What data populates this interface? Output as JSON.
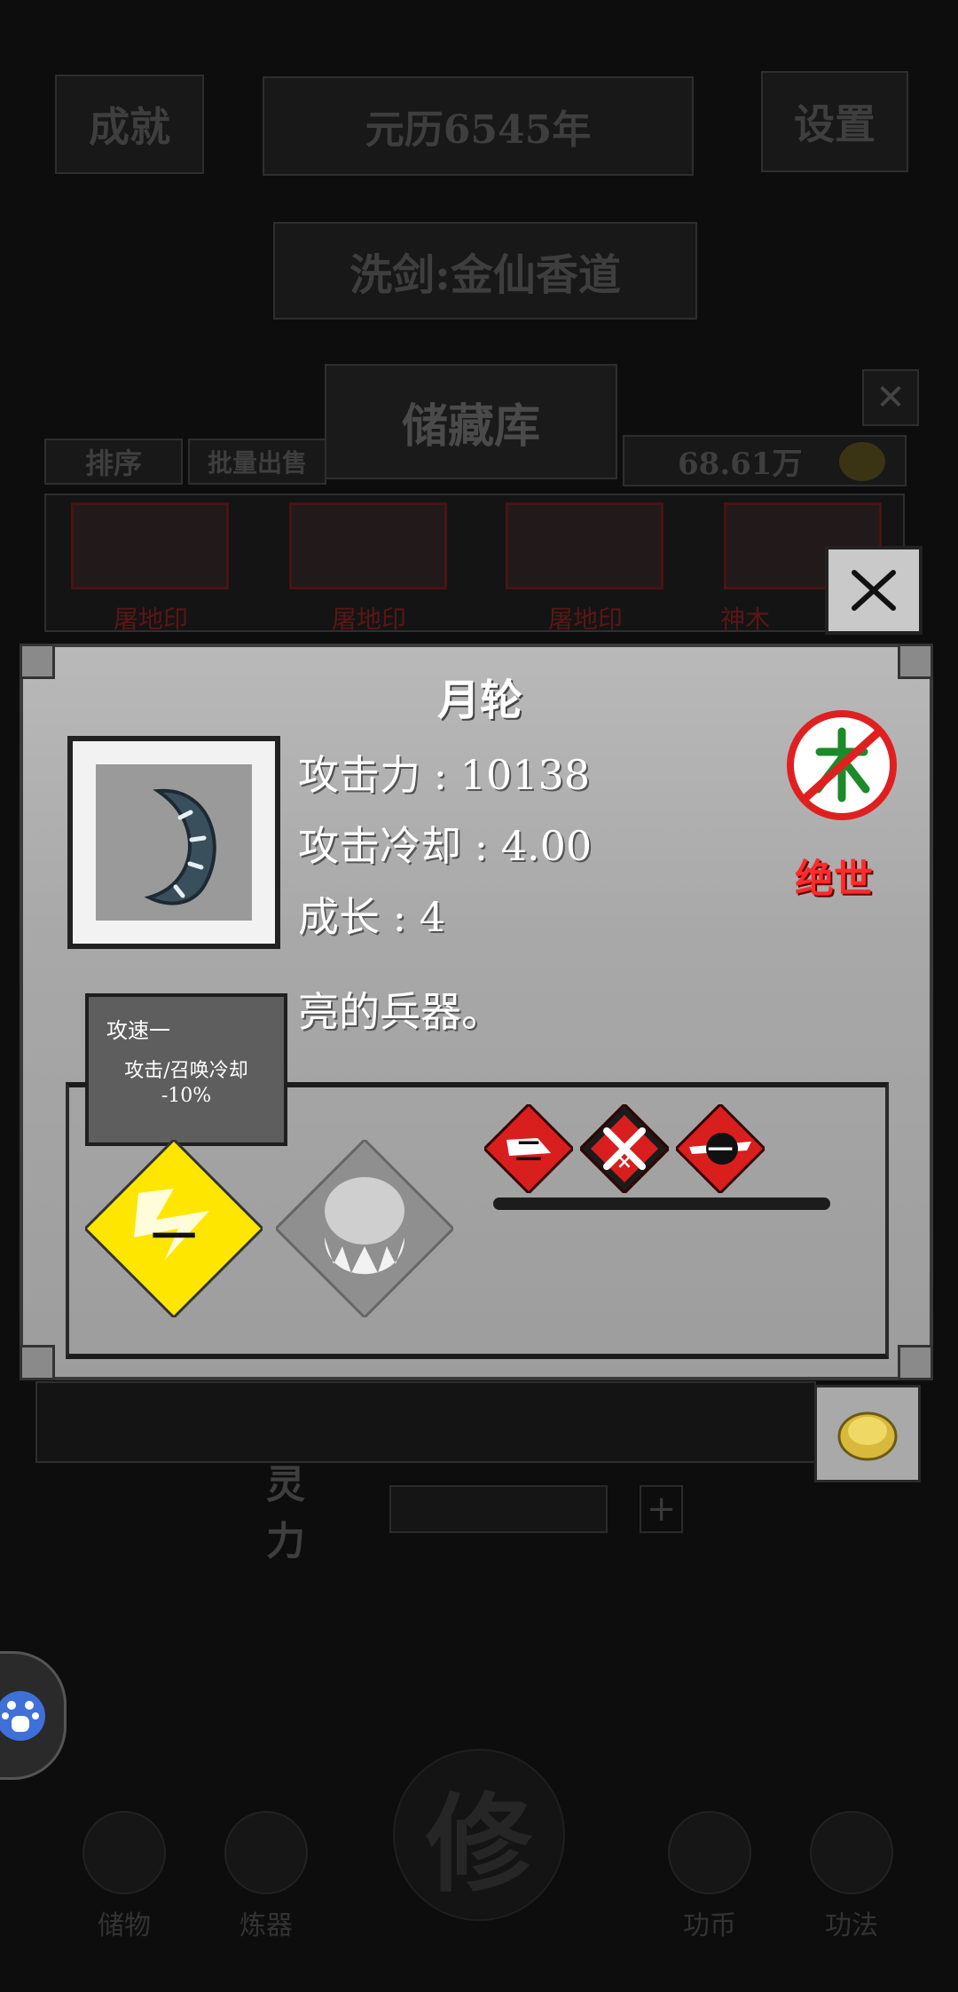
{
  "background": {
    "top_left_button": "成就",
    "top_date": "元历6545年",
    "top_right_button": "设置",
    "server_banner": "洗剑:金仙香道",
    "storage_title": "储藏库",
    "sort_label": "排序",
    "bulk_sell_label": "批量出售",
    "currency_amount": "68.61万",
    "storage_slots": [
      {
        "label": "屠地印"
      },
      {
        "label": "屠地印"
      },
      {
        "label": "屠地印"
      },
      {
        "label": "神木"
      }
    ],
    "stamina_label": "灵力",
    "bottom_nav": [
      {
        "label": "储物"
      },
      {
        "label": "炼器"
      },
      {
        "label": "修"
      },
      {
        "label": "功币"
      },
      {
        "label": "功法"
      }
    ]
  },
  "dialog": {
    "item_name": "月轮",
    "stats": [
      {
        "label": "攻击力",
        "value": "10138"
      },
      {
        "label": "攻击冷却",
        "value": "4.00"
      },
      {
        "label": "成长",
        "value": "4"
      }
    ],
    "element_icon": "wood-element-prohibited-icon",
    "rarity": "绝世",
    "description": "亮的兵器。",
    "tooltip": {
      "title": "攻速一",
      "body_line1": "攻击/召唤冷却",
      "body_line2": "-10%"
    },
    "skills": [
      {
        "icon": "lightning-skill-icon",
        "glyph": "一"
      },
      {
        "icon": "ghost-skill-icon",
        "glyph": ""
      }
    ],
    "badges": [
      {
        "icon": "badge-blade-two-icon",
        "glyph": "二"
      },
      {
        "icon": "badge-crossed-swords-icon",
        "glyph": "×"
      },
      {
        "icon": "badge-spear-one-icon",
        "glyph": "一"
      }
    ]
  },
  "colors": {
    "rarity_red": "#ff2b2b",
    "badge_red": "#d91e1e",
    "skill_yellow": "#ffe600"
  }
}
